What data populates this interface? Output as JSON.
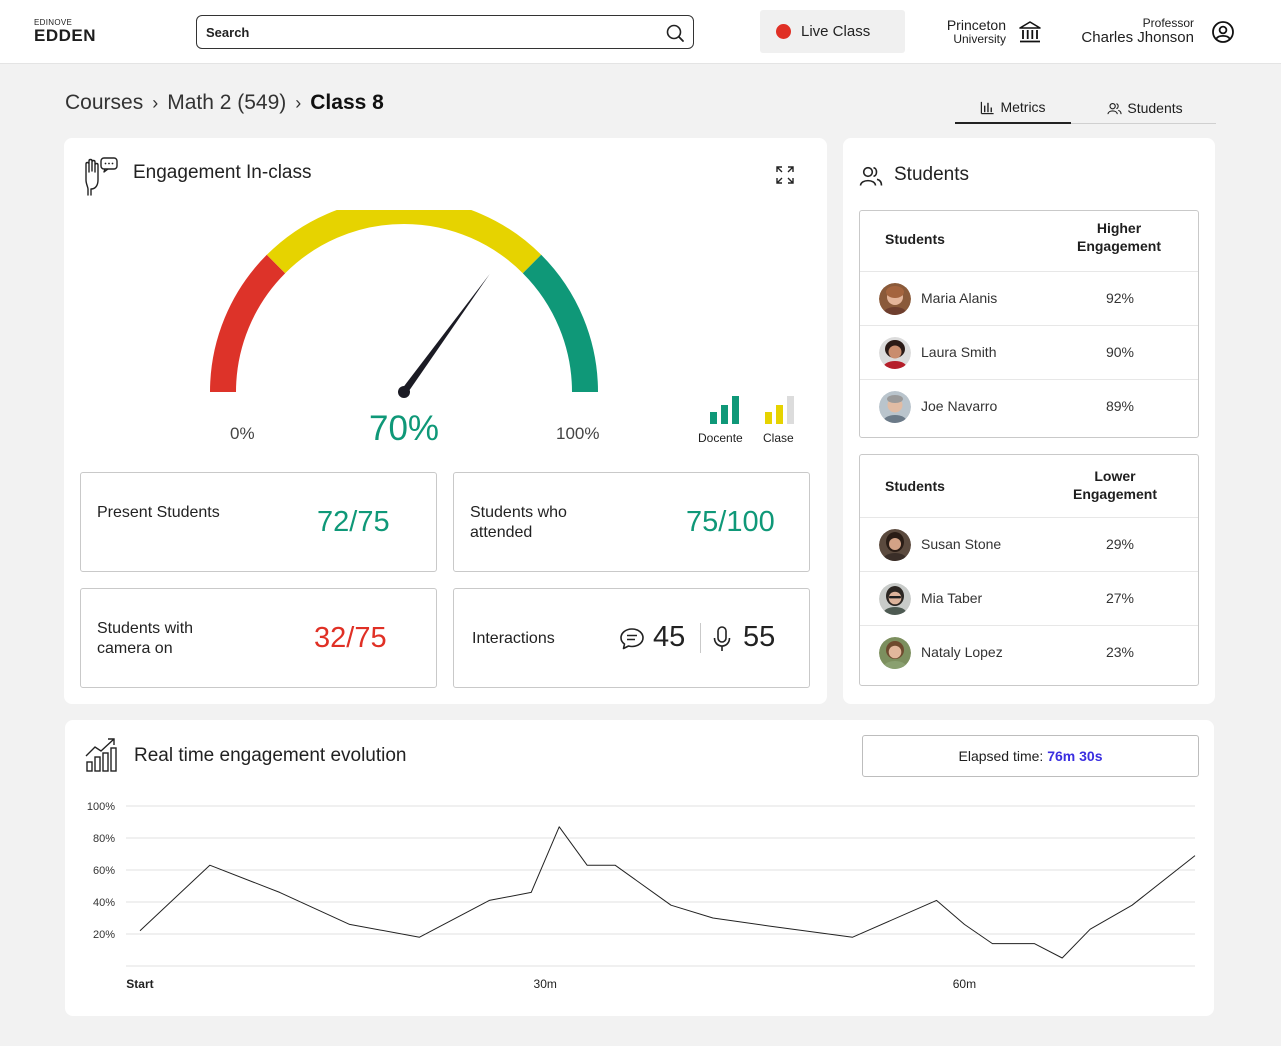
{
  "header": {
    "logo_small": "EDINOVE",
    "logo_big": "EDDEN",
    "search_placeholder": "Search",
    "live_label": "Live Class",
    "university_line1": "Princeton",
    "university_line2": "University",
    "professor_role": "Professor",
    "professor_name": "Charles Jhonson"
  },
  "breadcrumb": {
    "items": [
      "Courses",
      "Math 2 (549)"
    ],
    "current": "Class 8",
    "separator": "›"
  },
  "tabs": [
    {
      "label": "Metrics",
      "active": true
    },
    {
      "label": "Students",
      "active": false
    }
  ],
  "engagement": {
    "title": "Engagement In-class",
    "value_percent": 70,
    "value_label": "70%",
    "min_label": "0%",
    "max_label": "100%",
    "legend": [
      "Docente",
      "Clase"
    ],
    "gauge_colors": {
      "low": "#dd3329",
      "mid": "#e6d300",
      "high": "#0f9878"
    }
  },
  "stats": {
    "present_label": "Present Students",
    "present_value": "72/75",
    "attended_label": "Students who attended",
    "attended_value": "75/100",
    "camera_label": "Students with camera on",
    "camera_value": "32/75",
    "interactions_label": "Interactions",
    "chat_count": "45",
    "mic_count": "55"
  },
  "students_panel": {
    "title": "Students",
    "higher": {
      "col1": "Students",
      "col2": "Higher Engagement",
      "rows": [
        {
          "name": "Maria Alanis",
          "pct": "92%"
        },
        {
          "name": "Laura Smith",
          "pct": "90%"
        },
        {
          "name": "Joe Navarro",
          "pct": "89%"
        }
      ]
    },
    "lower": {
      "col1": "Students",
      "col2": "Lower Engagement",
      "rows": [
        {
          "name": "Susan Stone",
          "pct": "29%"
        },
        {
          "name": "Mia Taber",
          "pct": "27%"
        },
        {
          "name": "Nataly Lopez",
          "pct": "23%"
        }
      ]
    }
  },
  "evolution": {
    "title": "Real time engagement evolution",
    "elapsed_label": "Elapsed time:",
    "elapsed_value": "76m 30s"
  },
  "chart_data": {
    "type": "line",
    "title": "Real time engagement evolution",
    "xlabel": "",
    "ylabel": "",
    "ylim": [
      0,
      100
    ],
    "xlim": [
      0,
      76.5
    ],
    "y_ticks": [
      "100%",
      "80%",
      "60%",
      "40%",
      "20%"
    ],
    "y_tick_values": [
      100,
      80,
      60,
      40,
      20
    ],
    "x_ticks": [
      "Start",
      "30m",
      "60m"
    ],
    "x_tick_values": [
      1,
      30,
      60
    ],
    "grid": true,
    "series": [
      {
        "x": [
          1,
          6,
          11,
          16,
          21,
          26,
          29,
          31,
          33,
          35,
          39,
          42,
          46,
          52,
          58,
          60,
          62,
          65,
          67,
          69,
          72,
          76.5
        ],
        "y": [
          22,
          63,
          46,
          26,
          18,
          41,
          46,
          87,
          63,
          63,
          38,
          30,
          25,
          18,
          41,
          26,
          14,
          14,
          5,
          23,
          38,
          69
        ]
      }
    ]
  }
}
